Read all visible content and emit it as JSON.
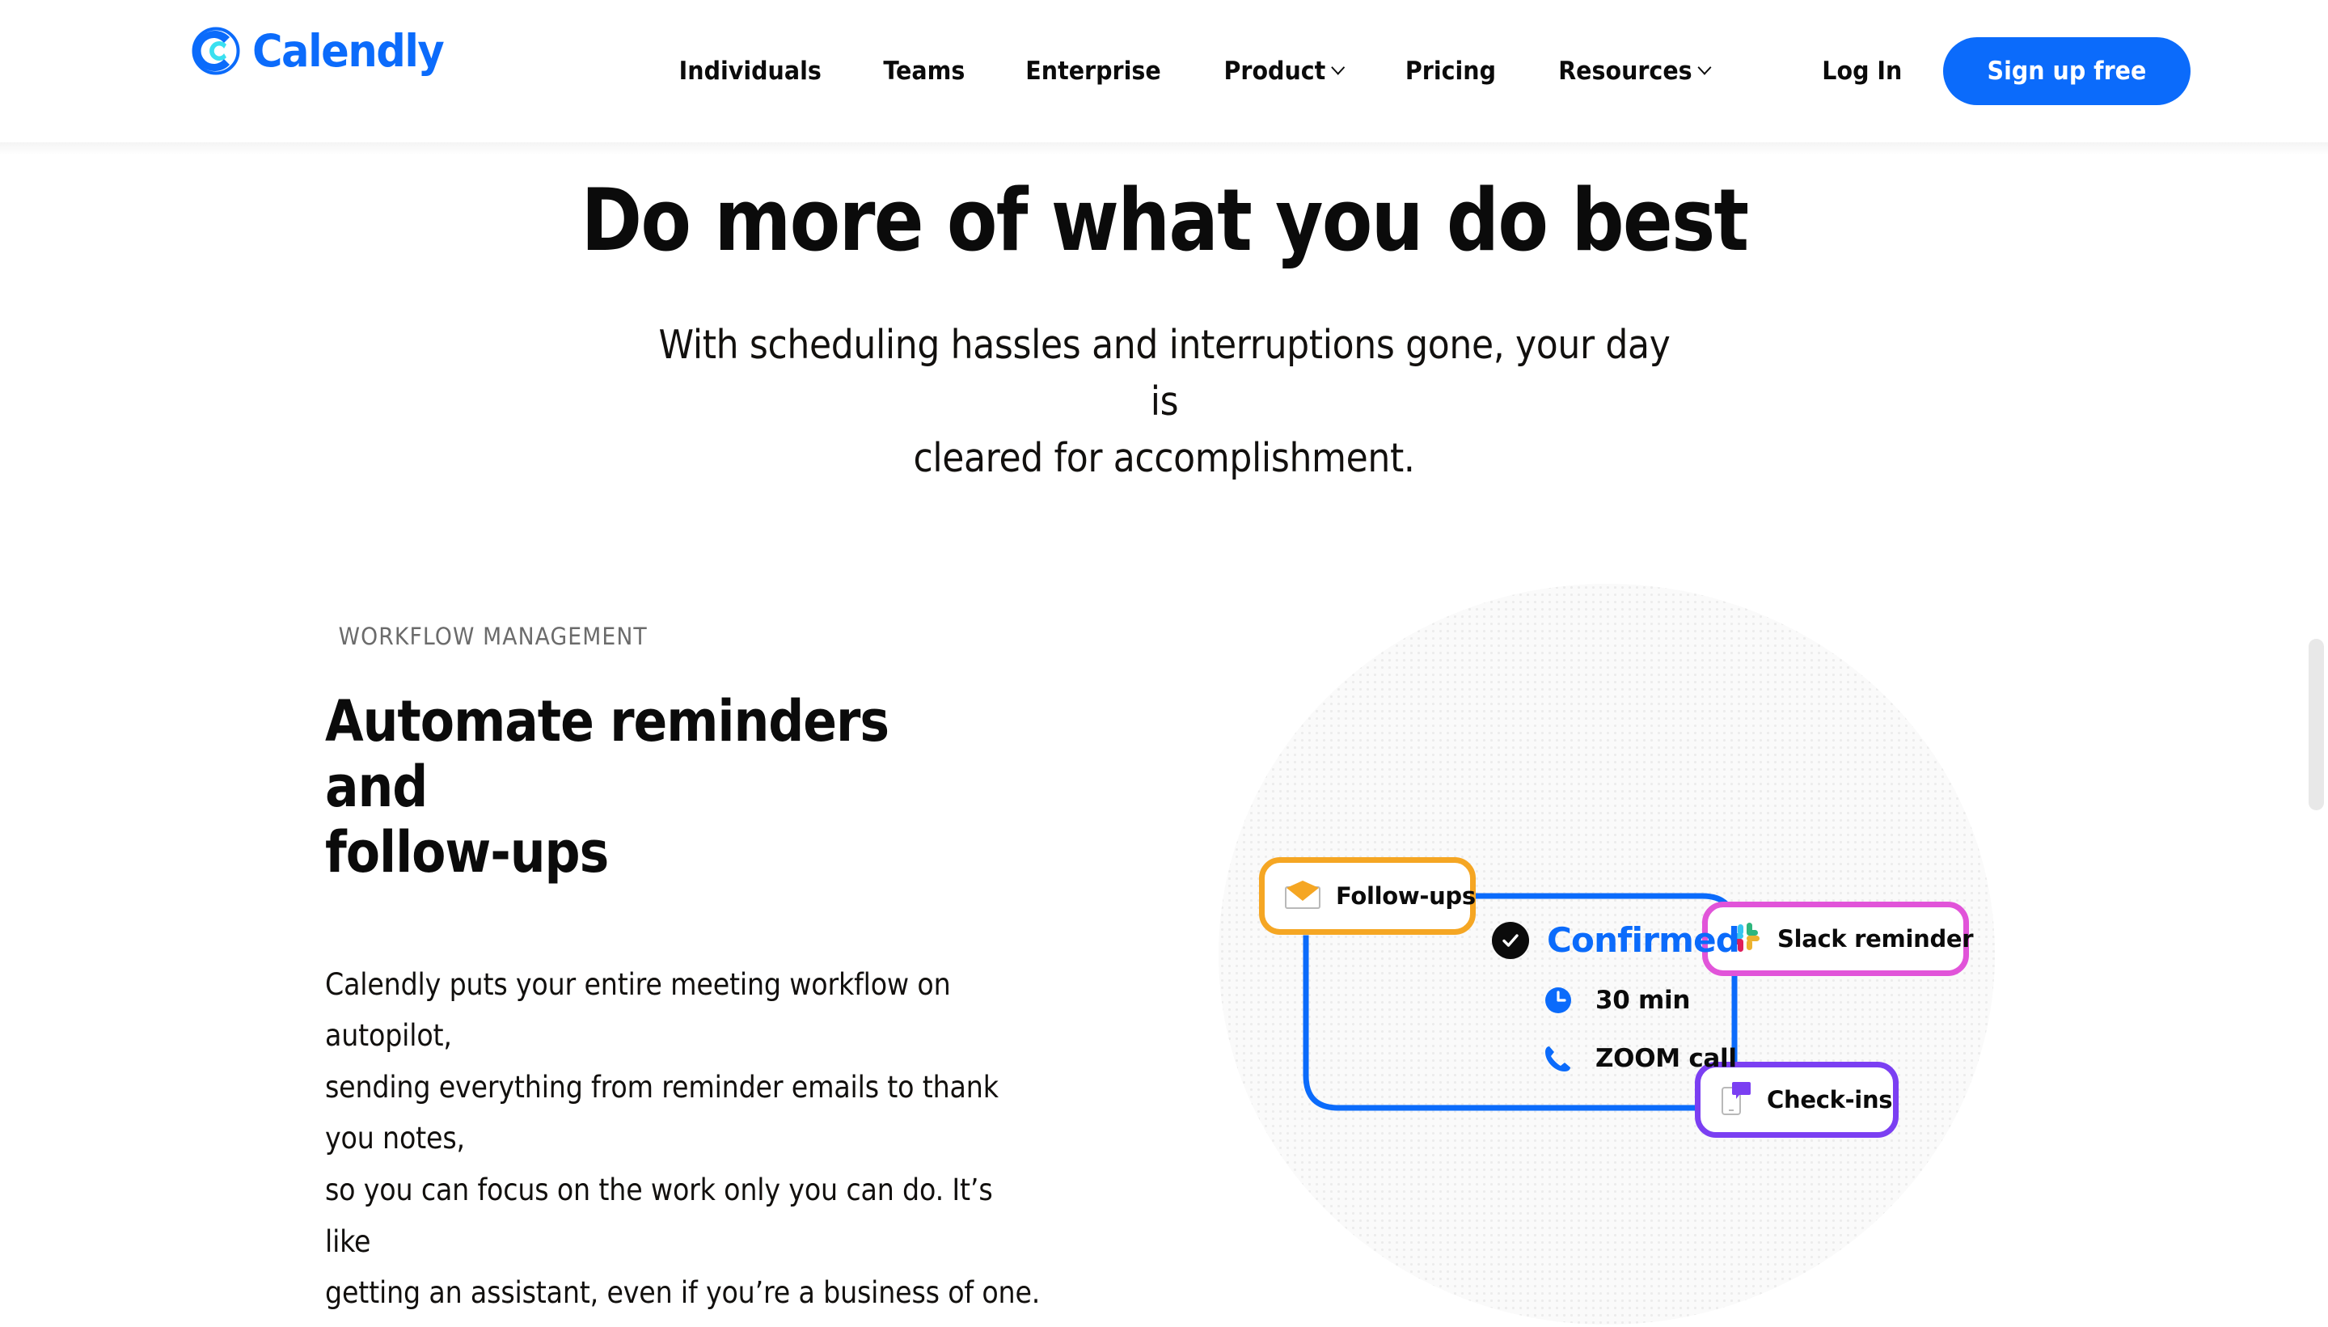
{
  "header": {
    "logo": {
      "text": "Calendly",
      "icon": "calendly-logo-icon",
      "brand_color": "#0b6bfb"
    },
    "nav": [
      {
        "label": "Individuals",
        "has_dropdown": false
      },
      {
        "label": "Teams",
        "has_dropdown": false
      },
      {
        "label": "Enterprise",
        "has_dropdown": false
      },
      {
        "label": "Product",
        "has_dropdown": true
      },
      {
        "label": "Pricing",
        "has_dropdown": false
      },
      {
        "label": "Resources",
        "has_dropdown": true
      }
    ],
    "login_label": "Log In",
    "signup_label": "Sign up free"
  },
  "hero": {
    "title": "Do more of what you do best",
    "subtitle_line1": "With scheduling hassles and interruptions gone, your day is",
    "subtitle_line2": "cleared for accomplishment."
  },
  "feature": {
    "eyebrow": "WORKFLOW MANAGEMENT",
    "title_line1": "Automate reminders and",
    "title_line2": "follow-ups",
    "body_line1": "Calendly puts your entire meeting workflow on autopilot,",
    "body_line2": "sending everything from reminder emails to thank you notes,",
    "body_line3": "so you can focus on the work only you can do. It’s like",
    "body_line4": "getting an assistant, even if you’re a business of one."
  },
  "illustration": {
    "cards": [
      {
        "label": "Follow-ups",
        "icon": "envelope-icon",
        "border_color": "#f5a623"
      },
      {
        "label": "Slack reminder",
        "icon": "slack-icon",
        "border_color": "#e154d9"
      },
      {
        "label": "Check-ins",
        "icon": "phone-chat-icon",
        "border_color": "#7b3ff2"
      }
    ],
    "confirmed": {
      "status": "Confirmed",
      "status_color": "#0b6bfb",
      "check_icon": "check-circle-icon",
      "duration": "30 min",
      "duration_icon": "clock-icon",
      "location": "ZOOM call",
      "location_icon": "phone-icon"
    },
    "connector_color": "#0b6bfb"
  },
  "scrollbar": {
    "name": "vertical-scrollbar"
  }
}
